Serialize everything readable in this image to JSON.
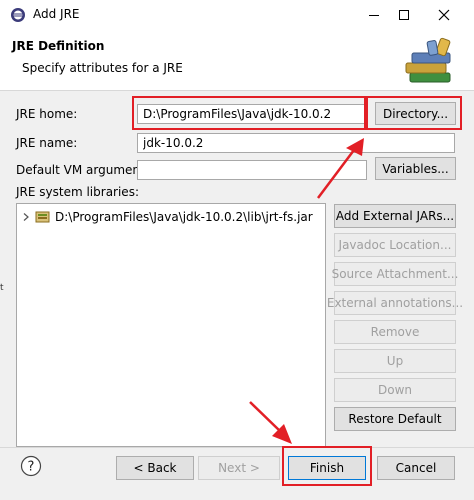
{
  "window": {
    "title": "Add JRE"
  },
  "banner": {
    "title": "JRE Definition",
    "subtitle": "Specify attributes for a JRE"
  },
  "form": {
    "jre_home_label": "JRE home:",
    "jre_home_value": "D:\\ProgramFiles\\Java\\jdk-10.0.2",
    "jre_name_label": "JRE name:",
    "jre_name_value": "jdk-10.0.2",
    "vm_args_label": "Default VM arguments:",
    "vm_args_value": "",
    "libraries_label": "JRE system libraries:"
  },
  "buttons": {
    "directory": "Directory...",
    "variables": "Variables...",
    "add_external_jars": "Add External JARs...",
    "javadoc_location": "Javadoc Location...",
    "source_attachment": "Source Attachment...",
    "external_annotations": "External annotations...",
    "remove": "Remove",
    "up": "Up",
    "down": "Down",
    "restore_default": "Restore Default",
    "back": "< Back",
    "next": "Next >",
    "finish": "Finish",
    "cancel": "Cancel"
  },
  "libraries": [
    {
      "label": "D:\\ProgramFiles\\Java\\jdk-10.0.2\\lib\\jrt-fs.jar",
      "icon": "jar-icon"
    }
  ],
  "edge_text": "t",
  "colors": {
    "highlight": "#e21f26",
    "button_face": "#e1e1e1",
    "dialog_bg": "#f0f0f0"
  }
}
